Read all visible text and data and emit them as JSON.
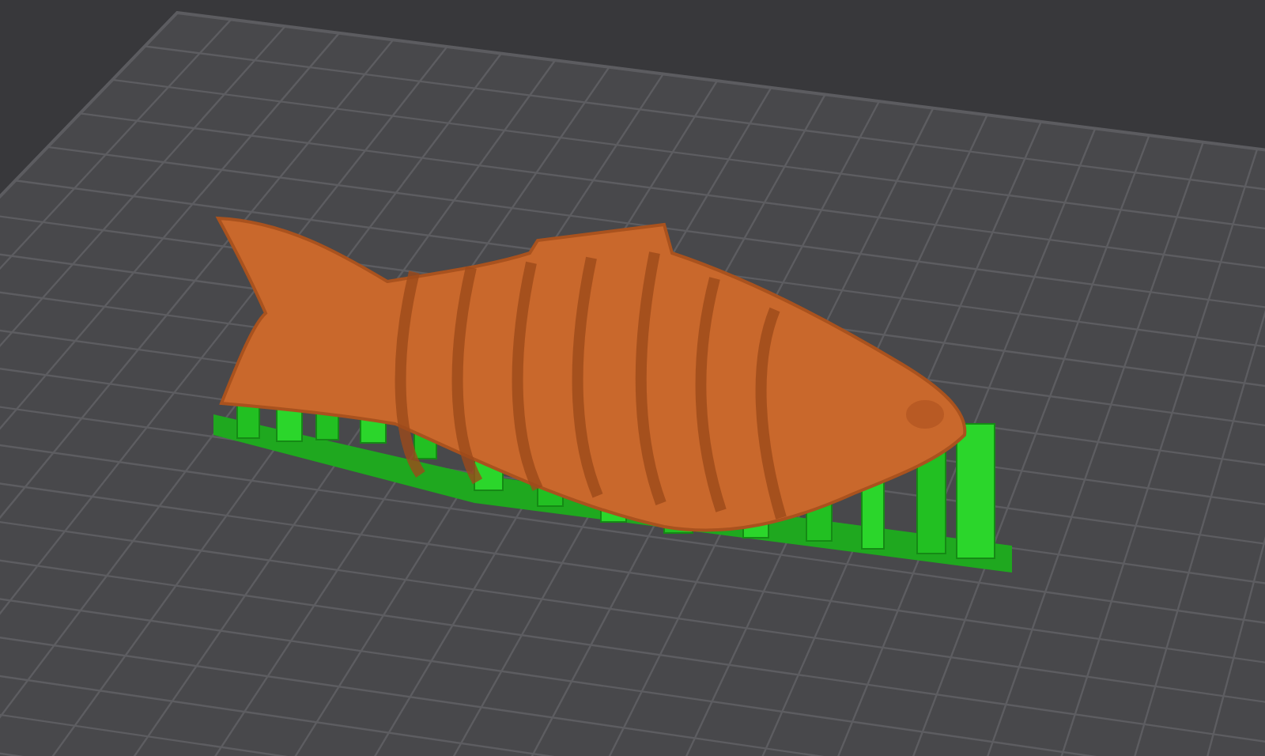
{
  "viewport": {
    "supports_visible": true
  }
}
